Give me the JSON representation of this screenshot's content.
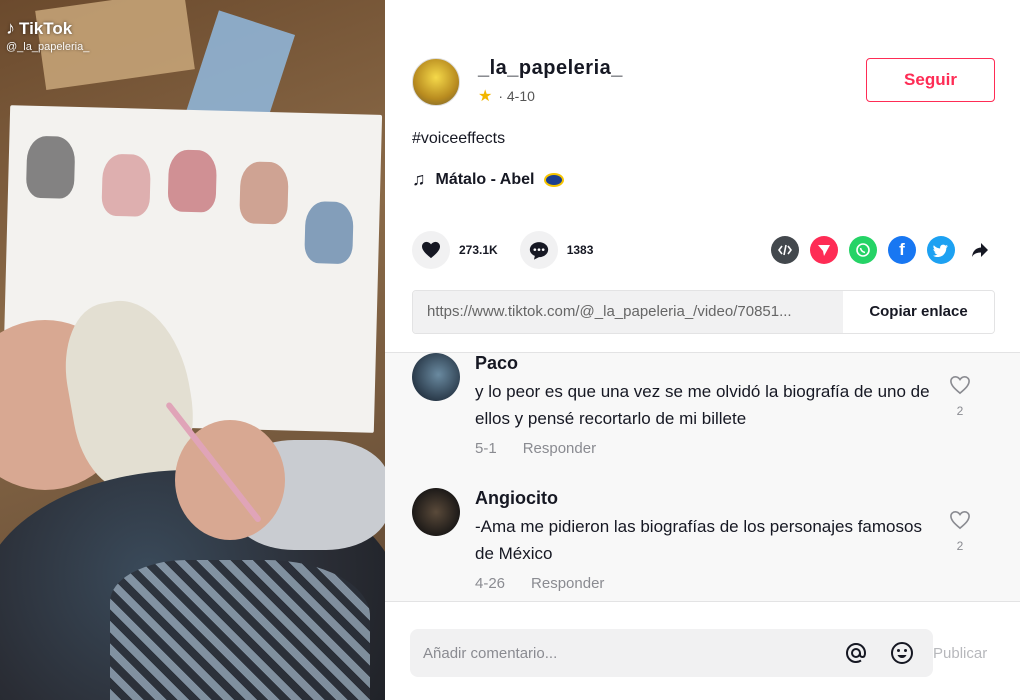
{
  "watermark": {
    "brand": "TikTok",
    "handle": "@_la_papeleria_"
  },
  "author": {
    "username": "_la_papeleria_",
    "date": "· 4-10"
  },
  "follow_label": "Seguir",
  "description": "#voiceeffects",
  "music": "Mátalo - Abel",
  "stats": {
    "likes": "273.1K",
    "comments": "1383"
  },
  "share_icons": [
    {
      "name": "embed-icon",
      "color": "#43484d"
    },
    {
      "name": "friends-icon",
      "color": "#fe2c55"
    },
    {
      "name": "whatsapp-icon",
      "color": "#25d366"
    },
    {
      "name": "facebook-icon",
      "color": "#1877f2"
    },
    {
      "name": "twitter-icon",
      "color": "#1da1f2"
    },
    {
      "name": "share-more-icon",
      "color": "#161823"
    }
  ],
  "link": {
    "url": "https://www.tiktok.com/@_la_papeleria_/video/70851...",
    "copy_label": "Copiar enlace"
  },
  "comments": [
    {
      "name": "Paco",
      "text": "y lo peor es que una vez se me olvidó la biografía de uno de ellos y pensé recortarlo de mi billete",
      "date": "5-1",
      "reply": "Responder",
      "likes": "2"
    },
    {
      "name": "Angiocito",
      "text": "-Ama me pidieron las biografías de los personajes famosos de México",
      "date": "4-26",
      "reply": "Responder",
      "likes": "2"
    }
  ],
  "composer": {
    "placeholder": "Añadir comentario...",
    "publish": "Publicar"
  }
}
